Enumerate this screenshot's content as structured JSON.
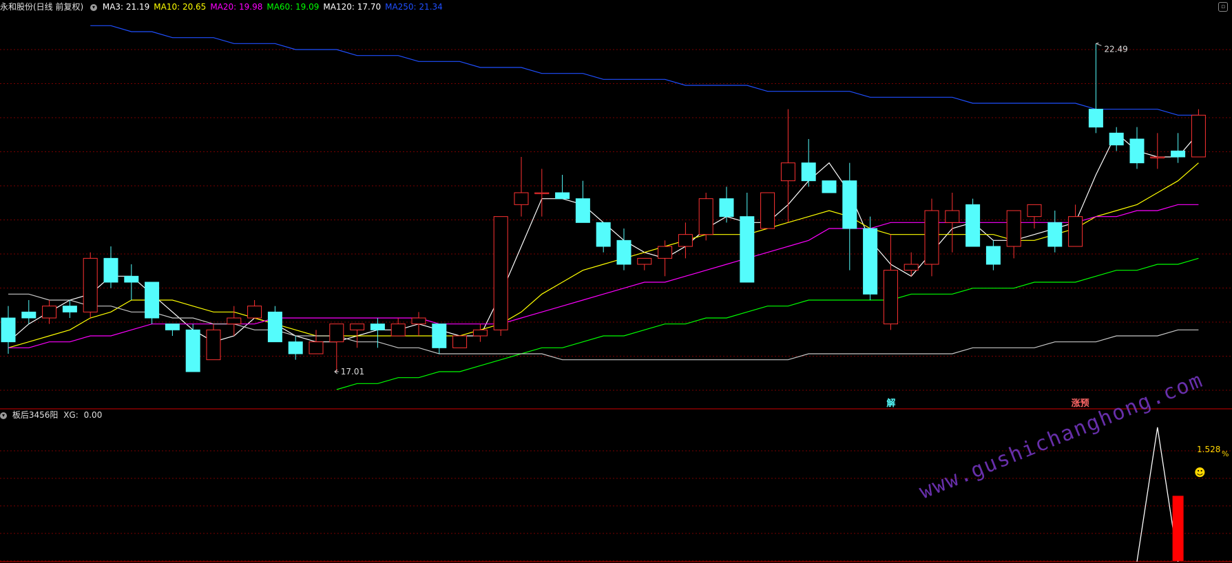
{
  "header": {
    "stock_title": "永和股份(日线 前复权)",
    "ma_labels": [
      {
        "name": "MA3",
        "value": "21.19",
        "color": "#ffffff"
      },
      {
        "name": "MA10",
        "value": "20.65",
        "color": "#ffff00"
      },
      {
        "name": "MA20",
        "value": "19.98",
        "color": "#ff00ff"
      },
      {
        "name": "MA60",
        "value": "19.09",
        "color": "#00ff00"
      },
      {
        "name": "MA120",
        "value": "17.70",
        "color": "#ffffff"
      },
      {
        "name": "MA250",
        "value": "21.34",
        "color": "#1f4fff"
      }
    ]
  },
  "sub_header": {
    "indicator_name": "板后3456阳",
    "xg_label": "XG",
    "xg_value": "0.00"
  },
  "watermark": "www.gushichanghong.com",
  "colors": {
    "up": "#ff3232",
    "down": "#54fcfc",
    "grid": "#7a0000",
    "axis": "#8b0000"
  },
  "chart_data": [
    {
      "type": "candlestick",
      "ylim": [
        16.4,
        23.0
      ],
      "annotations": {
        "high_label": "22.49",
        "high_index": 53,
        "low_label": "17.01",
        "low_index": 16,
        "markers": [
          {
            "text": "解",
            "index": 43,
            "color": "#54fcfc"
          },
          {
            "text": "涨预",
            "index": 52,
            "color": "#ff6666"
          }
        ]
      },
      "candles": [
        [
          17.9,
          17.5,
          17.3,
          18.1
        ],
        [
          18.0,
          17.9,
          17.8,
          18.2
        ],
        [
          17.9,
          18.1,
          17.8,
          18.2
        ],
        [
          18.1,
          18.0,
          17.9,
          18.2
        ],
        [
          18.0,
          18.9,
          17.9,
          19.0
        ],
        [
          18.9,
          18.5,
          18.4,
          19.1
        ],
        [
          18.6,
          18.5,
          18.2,
          18.8
        ],
        [
          18.5,
          17.9,
          17.8,
          18.5
        ],
        [
          17.8,
          17.7,
          17.6,
          17.8
        ],
        [
          17.7,
          17.0,
          17.0,
          17.8
        ],
        [
          17.2,
          17.7,
          17.2,
          17.8
        ],
        [
          17.8,
          17.9,
          17.6,
          18.1
        ],
        [
          17.9,
          18.1,
          17.9,
          18.2
        ],
        [
          18.0,
          17.5,
          17.6,
          18.1
        ],
        [
          17.5,
          17.3,
          17.2,
          17.6
        ],
        [
          17.3,
          17.5,
          17.3,
          17.7
        ],
        [
          17.5,
          17.8,
          17.0,
          17.8
        ],
        [
          17.7,
          17.8,
          17.4,
          17.8
        ],
        [
          17.8,
          17.7,
          17.4,
          17.9
        ],
        [
          17.6,
          17.8,
          17.6,
          17.9
        ],
        [
          17.8,
          17.9,
          17.6,
          18.0
        ],
        [
          17.8,
          17.4,
          17.3,
          17.8
        ],
        [
          17.4,
          17.6,
          17.4,
          17.6
        ],
        [
          17.6,
          17.7,
          17.5,
          17.8
        ],
        [
          17.7,
          19.6,
          17.6,
          19.6
        ],
        [
          19.8,
          20.0,
          19.6,
          20.6
        ],
        [
          20.0,
          20.0,
          19.6,
          20.4
        ],
        [
          20.0,
          19.9,
          19.9,
          20.3
        ],
        [
          19.9,
          19.5,
          19.5,
          20.2
        ],
        [
          19.5,
          19.1,
          19.0,
          19.5
        ],
        [
          19.2,
          18.8,
          18.7,
          19.4
        ],
        [
          18.8,
          18.9,
          18.7,
          18.9
        ],
        [
          18.9,
          19.1,
          18.6,
          19.2
        ],
        [
          19.1,
          19.3,
          18.9,
          19.5
        ],
        [
          19.3,
          19.9,
          19.2,
          20.0
        ],
        [
          19.9,
          19.6,
          19.5,
          20.1
        ],
        [
          19.6,
          18.5,
          19.2,
          20.0
        ],
        [
          19.4,
          20.0,
          19.4,
          20.0
        ],
        [
          20.2,
          20.5,
          19.5,
          21.4
        ],
        [
          20.5,
          20.2,
          20.1,
          20.9
        ],
        [
          20.2,
          20.0,
          20.3,
          20.3
        ],
        [
          20.2,
          19.4,
          18.7,
          20.5
        ],
        [
          19.4,
          18.3,
          18.2,
          19.6
        ],
        [
          17.8,
          18.7,
          17.7,
          19.3
        ],
        [
          18.7,
          18.8,
          18.6,
          19.0
        ],
        [
          18.8,
          19.7,
          18.6,
          19.9
        ],
        [
          19.5,
          19.7,
          19.0,
          20.0
        ],
        [
          19.8,
          19.1,
          19.1,
          19.9
        ],
        [
          19.1,
          18.8,
          18.7,
          19.2
        ],
        [
          19.1,
          19.7,
          18.9,
          19.7
        ],
        [
          19.6,
          19.8,
          19.4,
          19.8
        ],
        [
          19.5,
          19.1,
          19.0,
          19.7
        ],
        [
          19.1,
          19.6,
          19.1,
          19.8
        ],
        [
          21.4,
          21.1,
          21.0,
          22.5
        ],
        [
          21.0,
          20.8,
          20.7,
          21.1
        ],
        [
          20.9,
          20.5,
          20.4,
          21.1
        ],
        [
          20.6,
          20.6,
          20.4,
          21.0
        ],
        [
          20.7,
          20.6,
          20.5,
          21.0
        ],
        [
          20.6,
          21.3,
          20.6,
          21.4
        ]
      ],
      "ma_lines": [
        {
          "name": "MA3",
          "color": "#ffffff",
          "values": [
            17.5,
            17.8,
            18.0,
            18.2,
            18.3,
            18.6,
            18.6,
            18.3,
            18.0,
            17.7,
            17.5,
            17.6,
            17.9,
            17.8,
            17.6,
            17.5,
            17.5,
            17.6,
            17.7,
            17.7,
            17.8,
            17.7,
            17.6,
            17.6,
            18.3,
            19.1,
            19.9,
            19.9,
            19.8,
            19.5,
            19.2,
            19.0,
            18.9,
            19.1,
            19.4,
            19.6,
            19.5,
            19.5,
            19.8,
            20.2,
            20.5,
            20.0,
            19.2,
            18.8,
            18.6,
            19.0,
            19.4,
            19.5,
            19.2,
            19.2,
            19.3,
            19.4,
            19.5,
            20.3,
            21.0,
            20.7,
            20.6,
            20.6,
            21.0
          ]
        },
        {
          "name": "MA10",
          "color": "#ffff00",
          "values": [
            17.4,
            17.5,
            17.6,
            17.7,
            17.9,
            18.0,
            18.2,
            18.2,
            18.2,
            18.1,
            18.0,
            18.0,
            17.9,
            17.8,
            17.7,
            17.6,
            17.6,
            17.6,
            17.6,
            17.6,
            17.6,
            17.6,
            17.6,
            17.7,
            17.8,
            18.0,
            18.3,
            18.5,
            18.7,
            18.8,
            18.9,
            19.0,
            19.1,
            19.2,
            19.3,
            19.3,
            19.3,
            19.4,
            19.5,
            19.6,
            19.7,
            19.6,
            19.4,
            19.3,
            19.3,
            19.3,
            19.3,
            19.3,
            19.3,
            19.2,
            19.2,
            19.3,
            19.4,
            19.6,
            19.7,
            19.8,
            20.0,
            20.2,
            20.5
          ]
        },
        {
          "name": "MA20",
          "color": "#ff00ff",
          "values": [
            17.4,
            17.4,
            17.5,
            17.5,
            17.6,
            17.6,
            17.7,
            17.8,
            17.8,
            17.8,
            17.8,
            17.8,
            17.8,
            17.9,
            17.9,
            17.9,
            17.9,
            17.9,
            17.9,
            17.9,
            17.9,
            17.8,
            17.8,
            17.8,
            17.8,
            17.9,
            18.0,
            18.1,
            18.2,
            18.3,
            18.4,
            18.5,
            18.5,
            18.6,
            18.7,
            18.8,
            18.9,
            19.0,
            19.1,
            19.2,
            19.4,
            19.4,
            19.4,
            19.5,
            19.5,
            19.5,
            19.5,
            19.5,
            19.5,
            19.5,
            19.5,
            19.5,
            19.5,
            19.6,
            19.6,
            19.7,
            19.7,
            19.8,
            19.8
          ]
        },
        {
          "name": "MA60",
          "color": "#00ff00",
          "values": [
            null,
            null,
            null,
            null,
            null,
            null,
            null,
            null,
            null,
            null,
            null,
            null,
            null,
            null,
            null,
            null,
            16.7,
            16.8,
            16.8,
            16.9,
            16.9,
            17.0,
            17.0,
            17.1,
            17.2,
            17.3,
            17.4,
            17.4,
            17.5,
            17.6,
            17.6,
            17.7,
            17.8,
            17.8,
            17.9,
            17.9,
            18.0,
            18.1,
            18.1,
            18.2,
            18.2,
            18.2,
            18.2,
            18.2,
            18.3,
            18.3,
            18.3,
            18.4,
            18.4,
            18.4,
            18.5,
            18.5,
            18.5,
            18.6,
            18.7,
            18.7,
            18.8,
            18.8,
            18.9
          ]
        },
        {
          "name": "MA120",
          "color": "#c8c8c8",
          "values": [
            18.3,
            18.3,
            18.2,
            18.2,
            18.1,
            18.1,
            18.0,
            18.0,
            17.9,
            17.9,
            17.8,
            17.8,
            17.7,
            17.7,
            17.6,
            17.6,
            17.6,
            17.5,
            17.5,
            17.4,
            17.4,
            17.3,
            17.3,
            17.3,
            17.3,
            17.3,
            17.3,
            17.2,
            17.2,
            17.2,
            17.2,
            17.2,
            17.2,
            17.2,
            17.2,
            17.2,
            17.2,
            17.2,
            17.2,
            17.3,
            17.3,
            17.3,
            17.3,
            17.3,
            17.3,
            17.3,
            17.3,
            17.4,
            17.4,
            17.4,
            17.4,
            17.5,
            17.5,
            17.5,
            17.6,
            17.6,
            17.6,
            17.7,
            17.7
          ]
        },
        {
          "name": "MA250",
          "color": "#1f4fff",
          "values": [
            null,
            null,
            null,
            null,
            22.8,
            22.8,
            22.7,
            22.7,
            22.6,
            22.6,
            22.6,
            22.5,
            22.5,
            22.5,
            22.4,
            22.4,
            22.4,
            22.3,
            22.3,
            22.3,
            22.2,
            22.2,
            22.2,
            22.1,
            22.1,
            22.1,
            22.0,
            22.0,
            22.0,
            21.9,
            21.9,
            21.9,
            21.9,
            21.8,
            21.8,
            21.8,
            21.8,
            21.7,
            21.7,
            21.7,
            21.7,
            21.7,
            21.6,
            21.6,
            21.6,
            21.6,
            21.6,
            21.5,
            21.5,
            21.5,
            21.5,
            21.5,
            21.5,
            21.4,
            21.4,
            21.4,
            21.4,
            21.3,
            21.3
          ]
        }
      ]
    },
    {
      "type": "indicator",
      "name": "板后3456阳",
      "value_label": "1.528",
      "unit_label": "%",
      "emoji": "☻",
      "ylim": [
        0,
        1.6
      ],
      "line_values": [
        {
          "index": 55,
          "value": 0.0
        },
        {
          "index": 56,
          "value": 1.53
        },
        {
          "index": 57,
          "value": 0.0
        }
      ],
      "bars": [
        {
          "index": 57,
          "value": 0.75,
          "color": "#ff0000"
        }
      ]
    }
  ]
}
